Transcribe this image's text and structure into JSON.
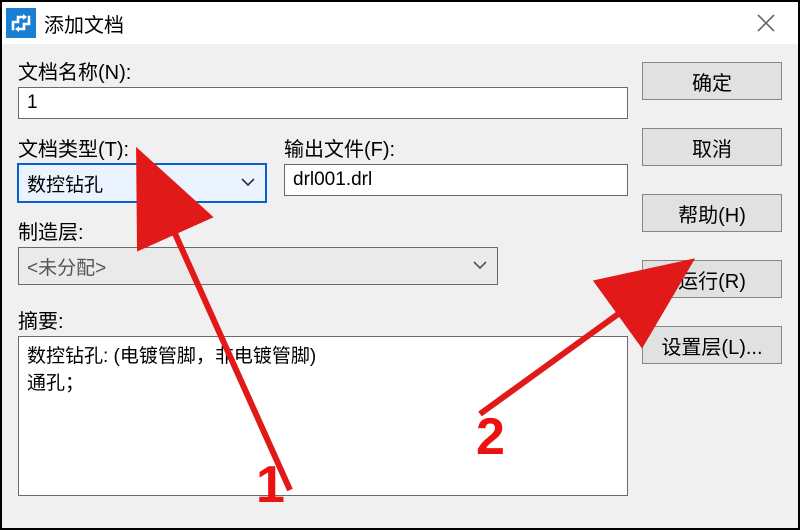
{
  "titlebar": {
    "title": "添加文档"
  },
  "labels": {
    "doc_name": "文档名称(N):",
    "doc_type": "文档类型(T):",
    "output_file": "输出文件(F):",
    "fab_layer": "制造层:",
    "summary": "摘要:"
  },
  "fields": {
    "doc_name_value": "1",
    "doc_type_value": "数控钻孔",
    "output_file_value": "drl001.drl",
    "fab_layer_value": "<未分配>",
    "summary_text": "数控钻孔: (电镀管脚，非电镀管脚)\n通孔；"
  },
  "buttons": {
    "ok": "确定",
    "cancel": "取消",
    "help": "帮助(H)",
    "run": "运行(R)",
    "set_layer": "设置层(L)..."
  },
  "annotations": {
    "label1": "1",
    "label2": "2",
    "color": "#e11919"
  }
}
